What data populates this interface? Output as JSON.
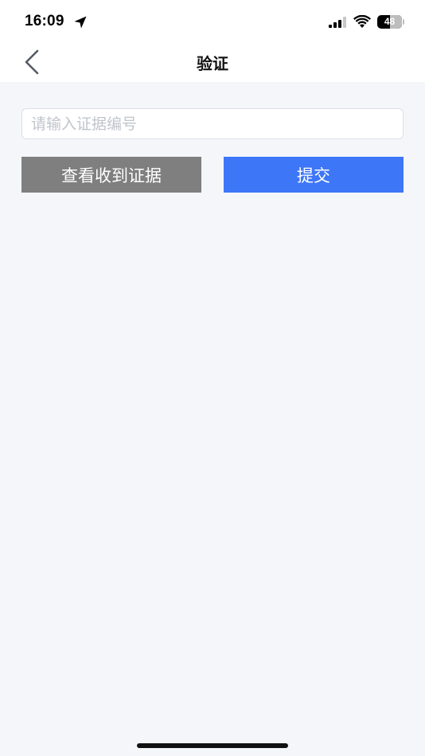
{
  "status_bar": {
    "time": "16:09",
    "battery_level": "48",
    "location_icon": "location-arrow-icon",
    "signal_icon": "cellular-signal-icon",
    "wifi_icon": "wifi-icon"
  },
  "nav": {
    "title": "验证",
    "back_icon": "chevron-left-icon"
  },
  "form": {
    "evidence_input": {
      "value": "",
      "placeholder": "请输入证据编号"
    },
    "view_received_label": "查看收到证据",
    "submit_label": "提交"
  },
  "colors": {
    "background": "#f5f6fa",
    "view_button": "#7f7f7f",
    "submit_button": "#3e76f8"
  }
}
